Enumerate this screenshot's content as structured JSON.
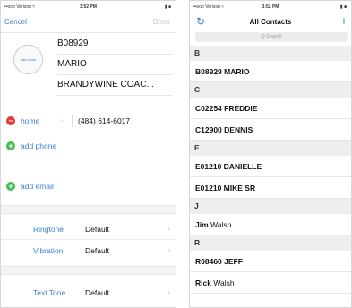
{
  "left_phone": {
    "status": {
      "carrier": "••ooo Verizon ≈",
      "time": "3:52 PM",
      "battery": "▮ ■"
    },
    "nav": {
      "cancel": "Cancel",
      "done": "Done"
    },
    "photo_label": "add photo",
    "fields": [
      "B08929",
      "MARIO",
      "BRANDYWINE COAC..."
    ],
    "phone_row": {
      "type": "home",
      "chevron": "›",
      "number": "(484) 614-6017",
      "icon": "remove-circle-icon"
    },
    "add_phone": "add phone",
    "add_email": "add email",
    "settings": [
      {
        "label": "Ringtone",
        "value": "Default"
      },
      {
        "label": "Vibration",
        "value": "Default"
      },
      {
        "label": "Text Tone",
        "value": "Default"
      }
    ],
    "colors": {
      "accent": "#3a7fd5",
      "delete": "#e03b30",
      "add": "#42bf4f"
    }
  },
  "right_phone": {
    "status": {
      "carrier": "••ooo Verizon ≈",
      "time": "3:52 PM",
      "battery": "▮ ■"
    },
    "nav": {
      "title": "All Contacts",
      "refresh_icon": "↻",
      "add_icon": "+"
    },
    "search_placeholder": "Q Search",
    "list": [
      {
        "kind": "header",
        "text": "B"
      },
      {
        "kind": "contact",
        "bold": "B08929 MARIO",
        "rest": ""
      },
      {
        "kind": "header",
        "text": "C"
      },
      {
        "kind": "contact",
        "bold": "C02254 FREDDIE",
        "rest": ""
      },
      {
        "kind": "contact",
        "bold": "C12900 DENNIS",
        "rest": ""
      },
      {
        "kind": "header",
        "text": "E"
      },
      {
        "kind": "contact",
        "bold": "E01210 DANIELLE",
        "rest": ""
      },
      {
        "kind": "contact",
        "bold": "E01210 MIKE SR",
        "rest": ""
      },
      {
        "kind": "header",
        "text": "J"
      },
      {
        "kind": "contact",
        "bold": "Jim",
        "rest": " Walsh"
      },
      {
        "kind": "header",
        "text": "R"
      },
      {
        "kind": "contact",
        "bold": "R08460 JEFF",
        "rest": ""
      },
      {
        "kind": "contact",
        "bold": "Rick",
        "rest": " Walsh"
      }
    ]
  }
}
